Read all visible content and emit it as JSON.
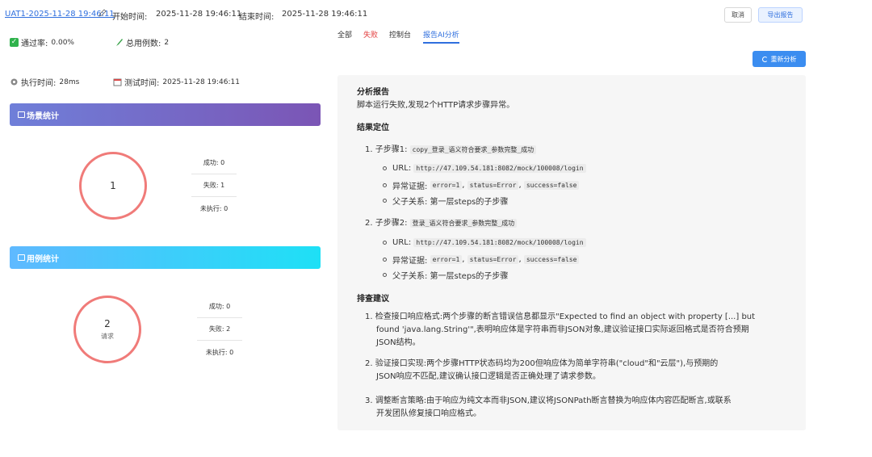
{
  "header": {
    "run_name": "UAT1-2025-11-28 19:46:11",
    "start_label": "开始时间:",
    "start_value": "2025-11-28 19:46:11",
    "end_label": "结束时间:",
    "end_value": "2025-11-28 19:46:11",
    "cancel_label": "取消",
    "export_label": "导出报告"
  },
  "stats": {
    "pass_rate_label": "通过率:",
    "pass_rate_value": "0.00%",
    "total_cases_label": "总用例数:",
    "total_cases_value": "2",
    "exec_time_label": "执行时间:",
    "exec_time_value": "28ms",
    "test_time_label": "测试时间:",
    "test_time_value": "2025-11-28 19:46:11"
  },
  "scene": {
    "title": "场景统计",
    "total": "1",
    "rows": [
      "成功: 0",
      "失败: 1",
      "未执行: 0"
    ]
  },
  "case": {
    "title": "用例统计",
    "total": "2",
    "unit": "请求",
    "rows": [
      "成功: 0",
      "失败: 2",
      "未执行: 0"
    ]
  },
  "tabs": {
    "all": "全部",
    "fail": "失败",
    "console": "控制台",
    "ai": "报告AI分析"
  },
  "reanalyze_label": "重新分析",
  "report": {
    "title": "分析报告",
    "summary": "脚本运行失败,发现2个HTTP请求步骤异常。",
    "locate_title": "结果定位",
    "step1_prefix": "1. 子步骤1:",
    "step1_code": "copy_登录_语义符合要求_参数完整_成功",
    "step2_prefix": "2. 子步骤2:",
    "step2_code": "登录_语义符合要求_参数完整_成功",
    "url_label": "URL:",
    "url_code": "http://47.109.54.181:8082/mock/100008/login",
    "evidence_label": "异常证据:",
    "ev1": "error=1",
    "ev2": "status=Error",
    "ev3": "success=false",
    "sep": ",",
    "parent_label": "父子关系: 第一层steps的子步骤",
    "suggest_title": "排查建议",
    "s1_l1": "1. 检查接口响应格式:两个步骤的断言错误信息都显示\"Expected to find an object with property [...] but",
    "s1_l2": "found 'java.lang.String'\",表明响应体是字符串而非JSON对象,建议验证接口实际返回格式是否符合预期",
    "s1_l3": "JSON结构。",
    "s2_l1": "2. 验证接口实现:两个步骤HTTP状态码均为200但响应体为简单字符串(\"cloud\"和\"云层\"),与预期的",
    "s2_l2": "JSON响应不匹配,建议确认接口逻辑是否正确处理了请求参数。",
    "s3_l1": "3. 调整断言策略:由于响应为纯文本而非JSON,建议将JSONPath断言替换为响应体内容匹配断言,或联系",
    "s3_l2": "开发团队修复接口响应格式。"
  },
  "icons": {
    "edit": "pencil-icon",
    "pass": "check-square-icon",
    "cases": "brush-icon",
    "exec": "gear-icon",
    "test": "calendar-icon"
  },
  "colors": {
    "accent": "#2f6fde",
    "fail": "#e23b3b",
    "ring": "#f07b79"
  }
}
